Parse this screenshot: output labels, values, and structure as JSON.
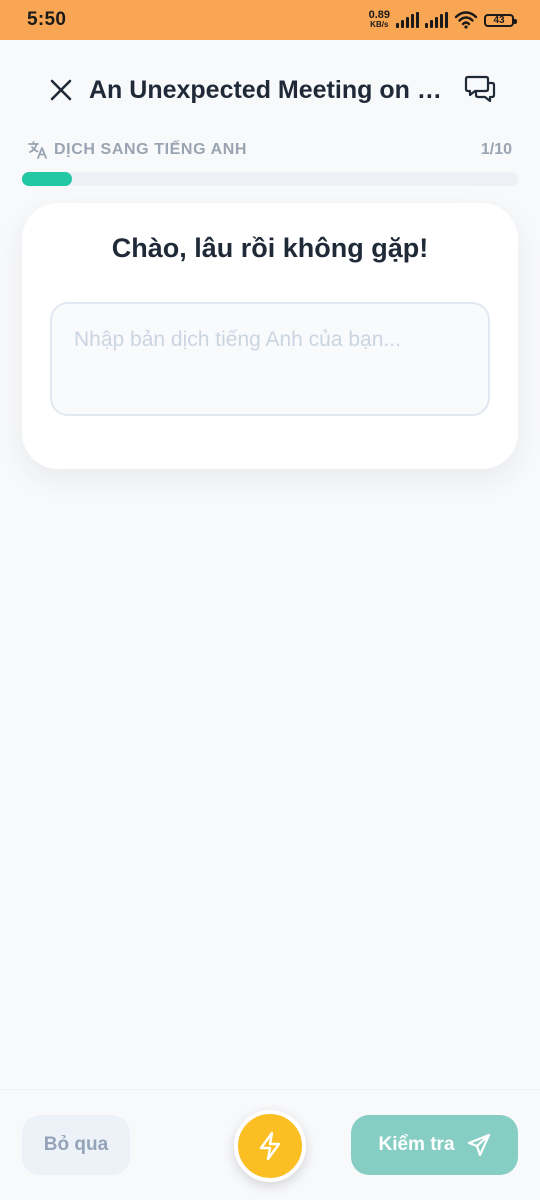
{
  "status_bar": {
    "time": "5:50",
    "net_speed_value": "0.89",
    "net_speed_unit": "KB/s",
    "battery": "43",
    "background": "#f8a653"
  },
  "header": {
    "title": "An Unexpected Meeting on t...",
    "close_icon": "close-icon",
    "chat_icon": "chat-bubbles-icon"
  },
  "task": {
    "label": "DỊCH SANG TIẾNG ANH",
    "icon": "translate-icon",
    "counter": "1/10",
    "progress_fraction": 0.1,
    "progress_color": "#22c7a3"
  },
  "card": {
    "prompt": "Chào, lâu rồi không gặp!",
    "answer_value": "",
    "answer_placeholder": "Nhập bản dịch tiếng Anh của bạn..."
  },
  "actions": {
    "skip_label": "Bỏ qua",
    "bolt_icon": "lightning-icon",
    "bolt_color": "#fbbf24",
    "check_label": "Kiểm tra",
    "check_icon": "send-icon",
    "check_color": "#86cec4"
  }
}
